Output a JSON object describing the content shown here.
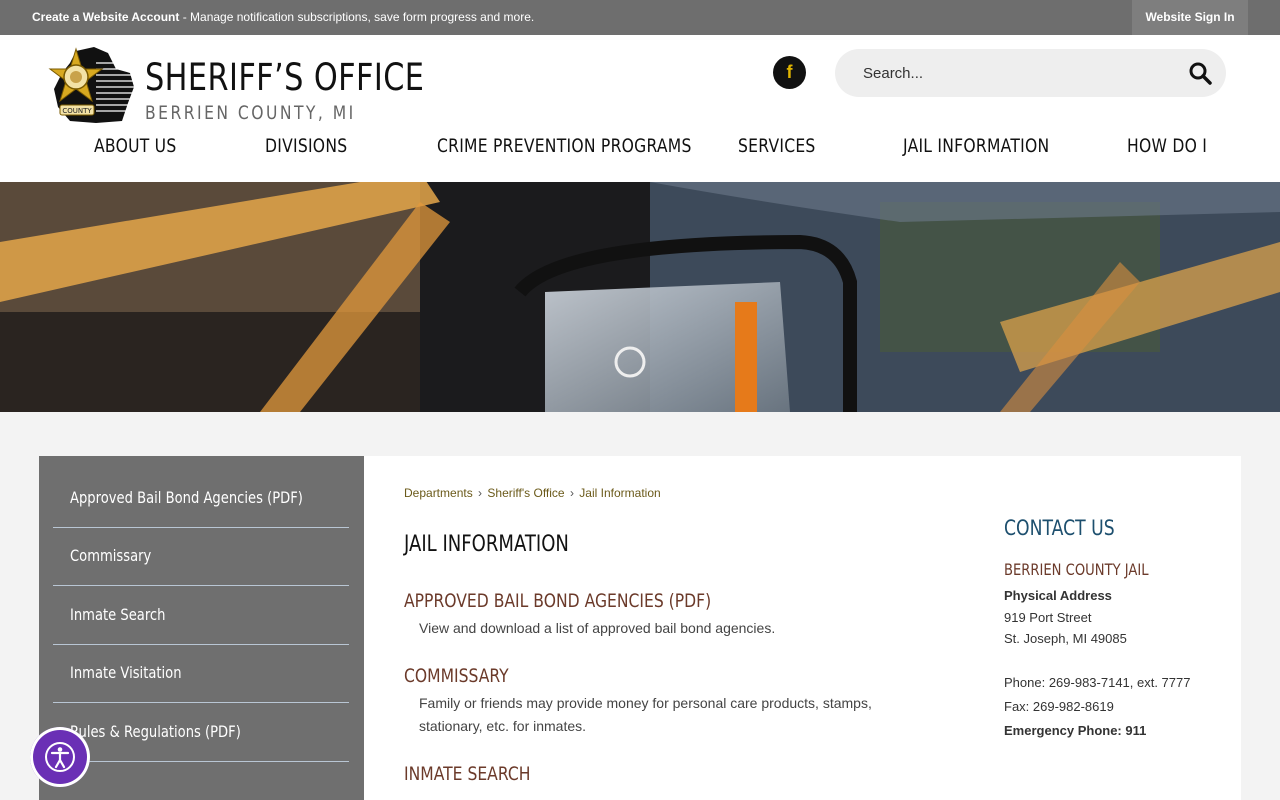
{
  "topbar": {
    "account_link": "Create a Website Account",
    "account_tail": " - Manage notification subscriptions, save form progress and more.",
    "signin": "Website Sign In"
  },
  "header": {
    "title": "SHERIFF’S OFFICE",
    "subtitle": "BERRIEN COUNTY, MI",
    "badge_text": "COUNTY",
    "facebook_letter": "f",
    "search_placeholder": "Search..."
  },
  "nav": {
    "items": [
      "ABOUT US",
      "DIVISIONS",
      "CRIME PREVENTION PROGRAMS",
      "SERVICES",
      "JAIL INFORMATION",
      "HOW DO I"
    ]
  },
  "sidebar": {
    "items": [
      "Approved Bail Bond Agencies (PDF)",
      "Commissary",
      "Inmate Search",
      "Inmate Visitation",
      "Rules & Regulations (PDF)"
    ]
  },
  "breadcrumb": {
    "items": [
      "Departments",
      "Sheriff's Office",
      "Jail Information"
    ],
    "separator": "›"
  },
  "main": {
    "title": "JAIL INFORMATION",
    "entries": [
      {
        "title": "APPROVED BAIL BOND AGENCIES (PDF)",
        "desc": "View and download a list of approved bail bond agencies."
      },
      {
        "title": "COMMISSARY",
        "desc": "Family or friends may provide money for personal care products, stamps, stationary, etc. for inmates."
      },
      {
        "title": "INMATE SEARCH",
        "desc": ""
      }
    ]
  },
  "contact": {
    "heading": "CONTACT US",
    "org": "BERRIEN COUNTY JAIL",
    "address_label": "Physical Address",
    "street": "919 Port Street",
    "city": "St. Joseph, MI 49085",
    "phone": "Phone: 269-983-7141, ext. 7777",
    "fax": "Fax: 269-982-8619",
    "emergency": "Emergency Phone: 911"
  },
  "colors": {
    "topbar": "#6e6e6e",
    "sidebar": "#6f6f6f",
    "entry_title": "#6b3a2a",
    "contact_heading": "#1d4f6e",
    "accessibility": "#6a2fb5"
  }
}
